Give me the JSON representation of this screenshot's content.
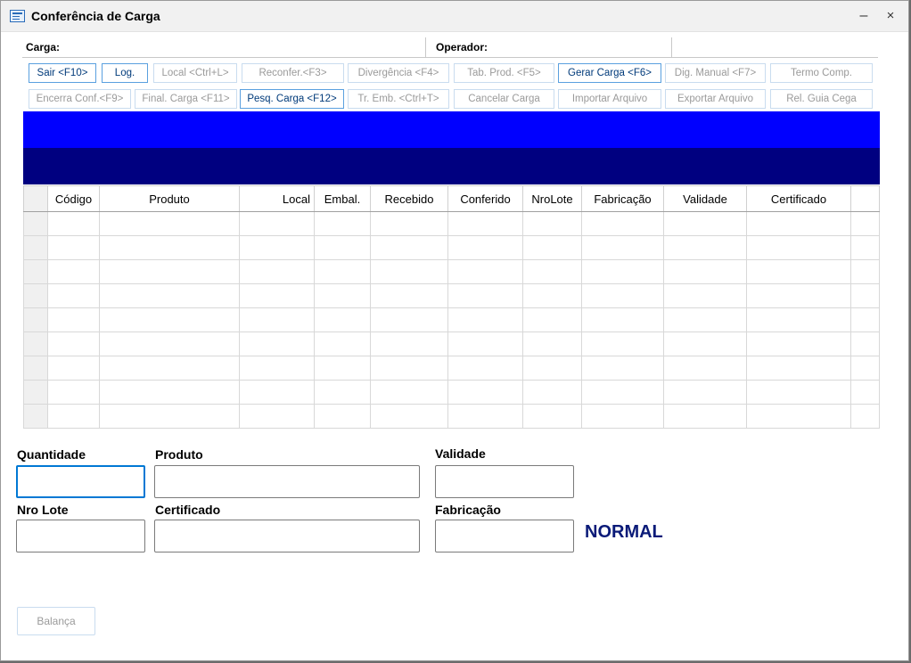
{
  "window": {
    "title": "Conferência de Carga",
    "minimize": "–",
    "close": "×"
  },
  "info": {
    "carga_label": "Carga:",
    "operador_label": "Operador:"
  },
  "toolbar": {
    "row1": [
      {
        "label": "Sair <F10>",
        "enabled": true
      },
      {
        "label": "Log.",
        "enabled": true
      },
      {
        "label": "Local <Ctrl+L>",
        "enabled": false
      },
      {
        "label": "Reconfer.<F3>",
        "enabled": false
      },
      {
        "label": "Divergência <F4>",
        "enabled": false
      },
      {
        "label": "Tab. Prod. <F5>",
        "enabled": false
      },
      {
        "label": "Gerar Carga <F6>",
        "enabled": true
      },
      {
        "label": "Dig. Manual <F7>",
        "enabled": false
      },
      {
        "label": "Termo Comp.",
        "enabled": false
      }
    ],
    "row2": [
      {
        "label": "Encerra Conf.<F9>",
        "enabled": false
      },
      {
        "label": "Final. Carga <F11>",
        "enabled": false
      },
      {
        "label": "Pesq. Carga <F12>",
        "enabled": true
      },
      {
        "label": "Tr. Emb. <Ctrl+T>",
        "enabled": false
      },
      {
        "label": "Cancelar Carga",
        "enabled": false
      },
      {
        "label": "Importar Arquivo",
        "enabled": false
      },
      {
        "label": "Exportar Arquivo",
        "enabled": false
      },
      {
        "label": "Rel. Guia Cega",
        "enabled": false
      }
    ]
  },
  "grid": {
    "columns": [
      "Código",
      "Produto",
      "Local",
      "Embal.",
      "Recebido",
      "Conferido",
      "NroLote",
      "Fabricação",
      "Validade",
      "Certificado"
    ],
    "row_count": 9
  },
  "form": {
    "quantidade_label": "Quantidade",
    "produto_label": "Produto",
    "validade_label": "Validade",
    "nro_lote_label": "Nro Lote",
    "certificado_label": "Certificado",
    "fabricacao_label": "Fabricação",
    "quantidade_value": "",
    "produto_value": "",
    "validade_value": "",
    "nro_lote_value": "",
    "certificado_value": "",
    "fabricacao_value": "",
    "status": "NORMAL",
    "status_color": "#0a1a78"
  },
  "footer": {
    "balanca_label": "Balança"
  },
  "colors": {
    "band_top": "#0000ff",
    "band_bottom": "#000080",
    "button_border": "#5aa0df"
  }
}
